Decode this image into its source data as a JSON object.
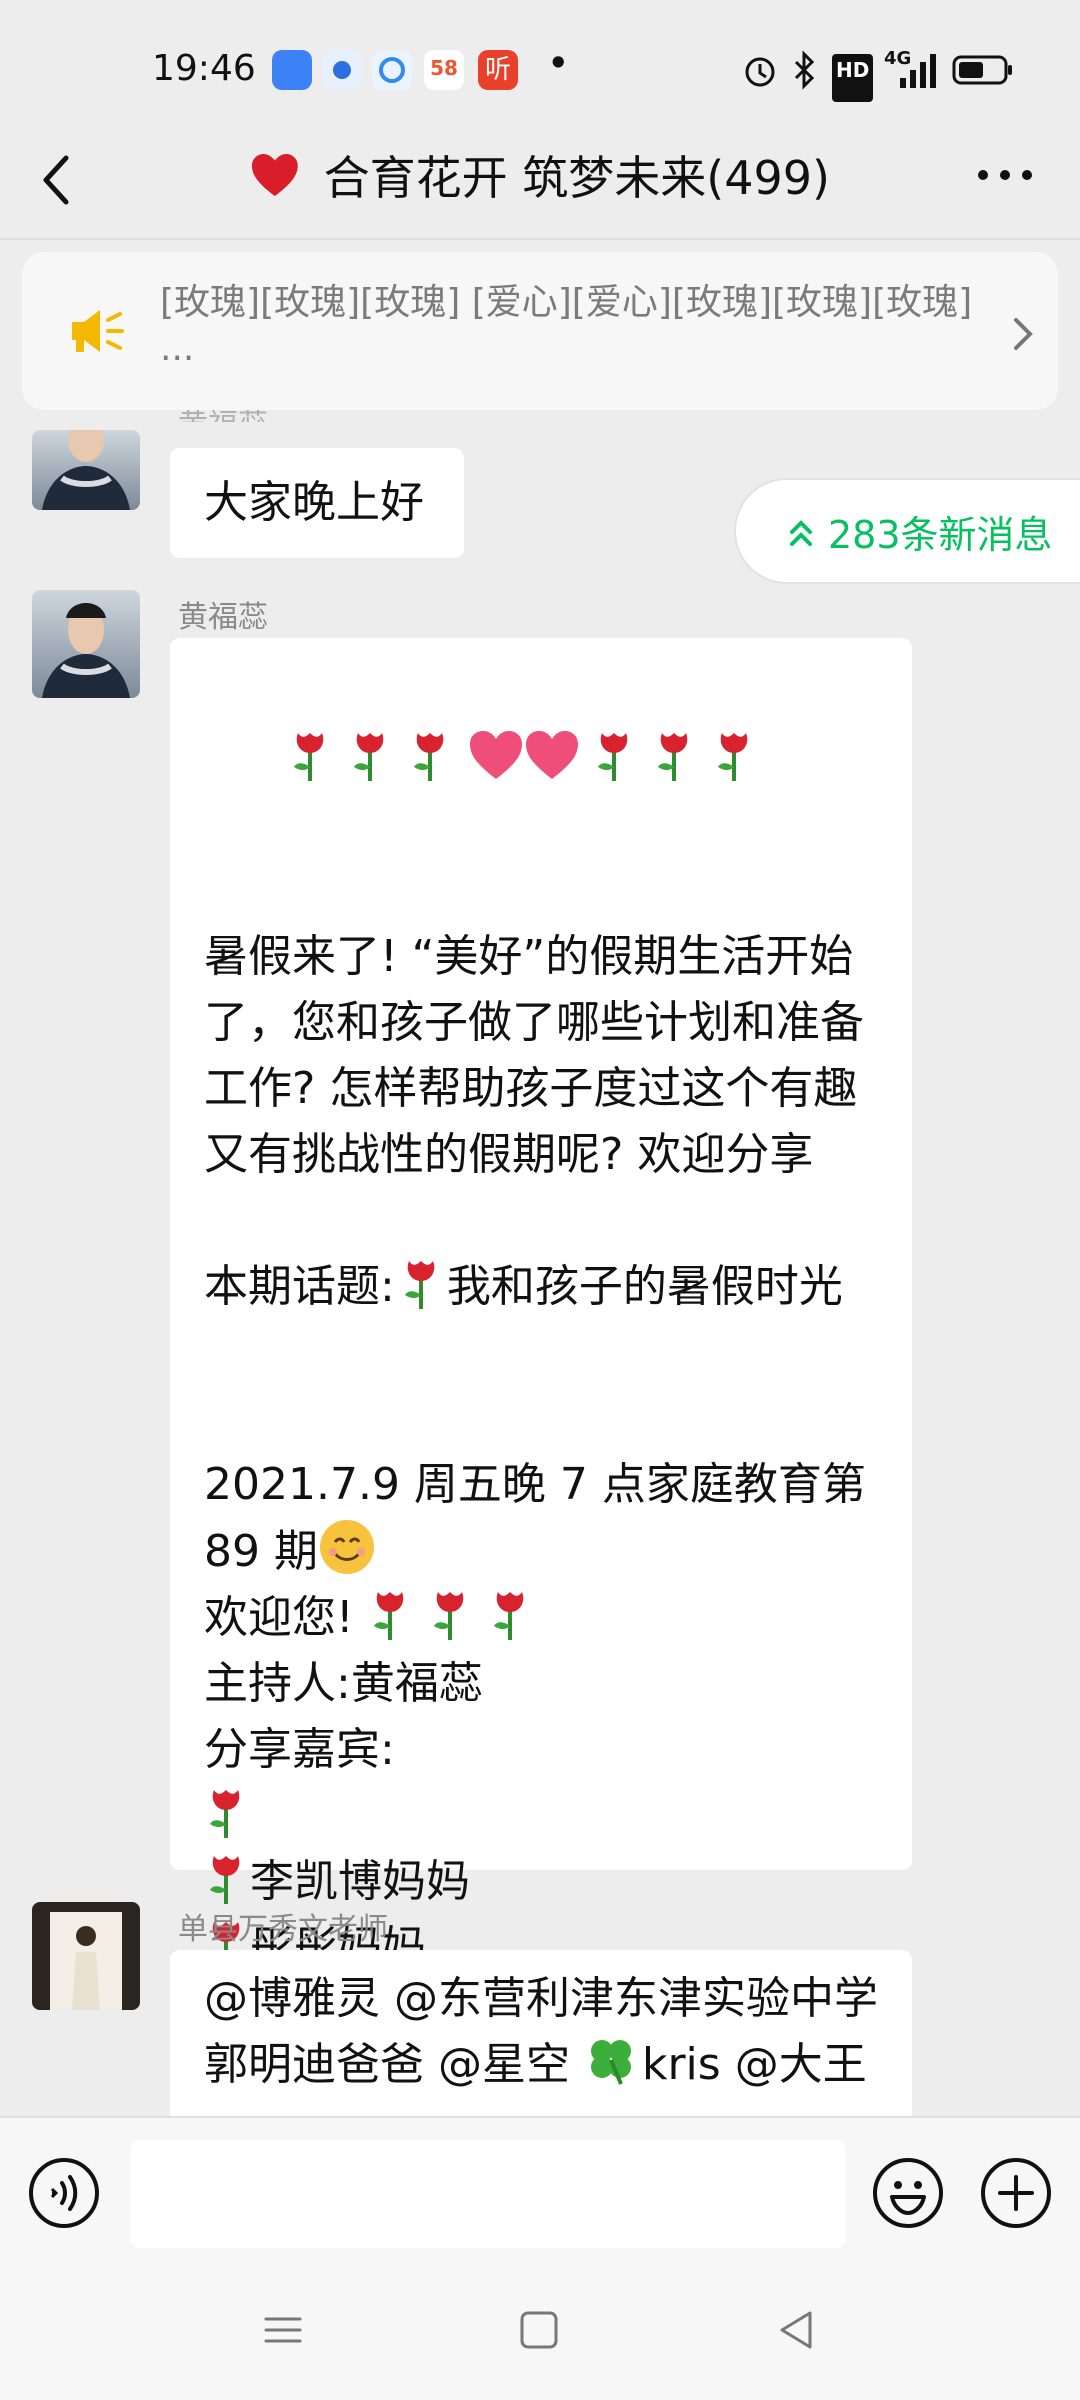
{
  "status_bar": {
    "time": "19:46",
    "app_icons": [
      "app-icon-blue",
      "app-icon-target",
      "app-icon-browser",
      "58",
      "听"
    ],
    "dot": "•",
    "right_icons": [
      "alarm-icon",
      "bluetooth-icon",
      "HD",
      "4G",
      "signal-icon",
      "battery-icon"
    ]
  },
  "header": {
    "title": "合育花开 筑梦未来(499)",
    "back_icon": "chevron-left-icon",
    "more_icon": "more-dots-icon"
  },
  "announcement": {
    "text": "[玫瑰][玫瑰][玫瑰] [爱心][爱心][玫瑰][玫瑰][玫瑰]\n..."
  },
  "new_messages_badge": "283条新消息",
  "messages": [
    {
      "sender": "黄福蕊",
      "lines": [
        "大家晚上好"
      ]
    },
    {
      "sender": "黄福蕊",
      "lines": [
        "",
        "",
        "暑假来了! “美好”的假期生活开始",
        "了，您和孩子做了哪些计划和准备",
        "工作? 怎样帮助孩子度过这个有趣",
        "又有挑战性的假期呢? 欢迎分享",
        "",
        "本期话题:",
        "",
        "",
        "2021.7.9 周五晚 7 点家庭教育第",
        "89 期",
        "欢迎您!",
        "主持人:黄福蕊",
        "分享嘉宾:",
        "",
        "李凯博妈妈",
        "彤彤妈妈"
      ],
      "topic_text": "我和孩子的暑假时光"
    },
    {
      "sender": "单县万秀文老师",
      "lines": [
        "@博雅灵 @东营利津东津实验中学",
        "郭明迪爸爸 @星空 ",
        "kris @大王"
      ]
    }
  ],
  "input_bar": {
    "placeholder": "",
    "voice_icon": "voice-icon",
    "emoji_icon": "emoji-icon",
    "plus_icon": "plus-icon"
  },
  "nav_bar": [
    "menu-icon",
    "home-square-icon",
    "back-triangle-icon"
  ]
}
